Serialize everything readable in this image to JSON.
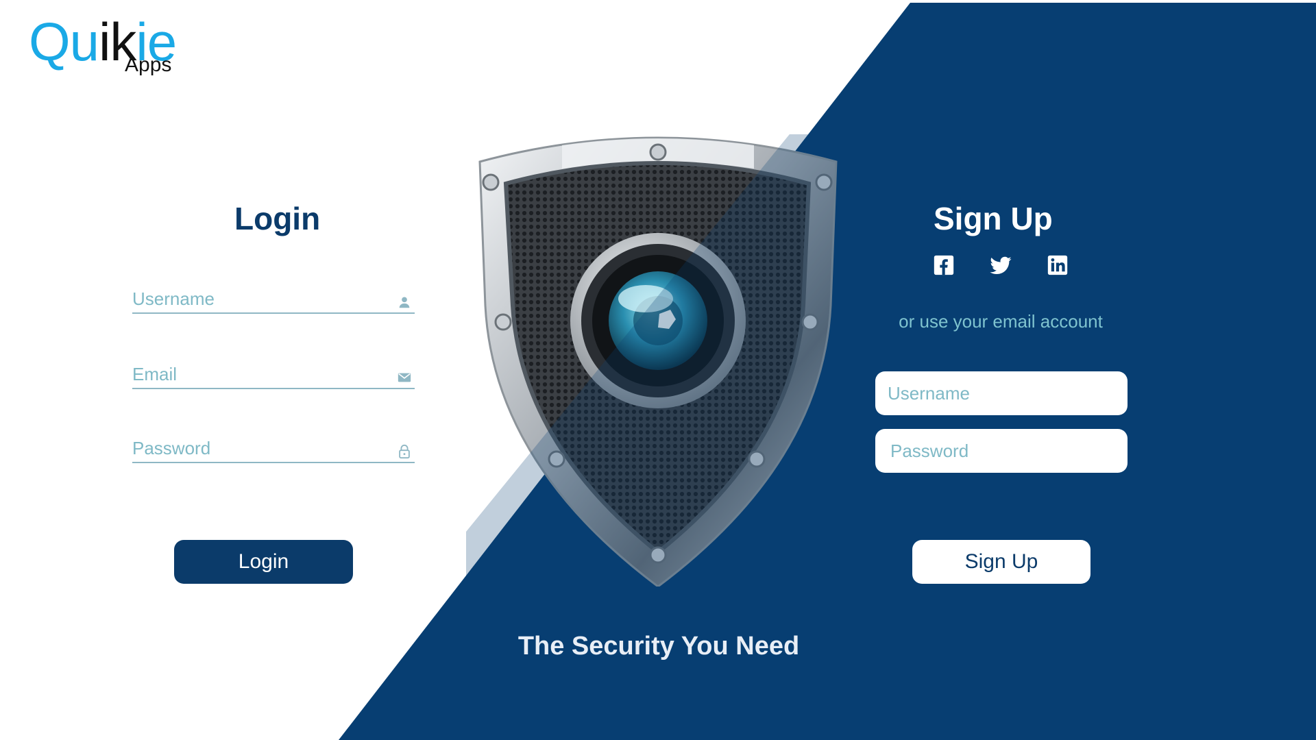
{
  "logo": {
    "part1": "Qu",
    "part2": "ik",
    "part3": "ie",
    "sub": "Apps",
    "brand_blue": "#1aa9e6",
    "dark": "#111111"
  },
  "colors": {
    "navy": "#073e72",
    "button_navy": "#0b3b6a",
    "teal_text": "#7fb9c6",
    "white": "#ffffff"
  },
  "login": {
    "title": "Login",
    "fields": [
      {
        "label": "Username",
        "icon": "user-icon"
      },
      {
        "label": "Email",
        "icon": "mail-icon"
      },
      {
        "label": "Password",
        "icon": "lock-icon"
      }
    ],
    "button": "Login"
  },
  "center": {
    "image": "security-shield-camera",
    "tagline": "The Security You Need"
  },
  "signup": {
    "title": "Sign Up",
    "social": [
      "facebook-icon",
      "twitter-icon",
      "linkedin-icon"
    ],
    "alt_text": "or use your email account",
    "username_placeholder": "Username",
    "password_placeholder": "Password",
    "button": "Sign Up"
  }
}
